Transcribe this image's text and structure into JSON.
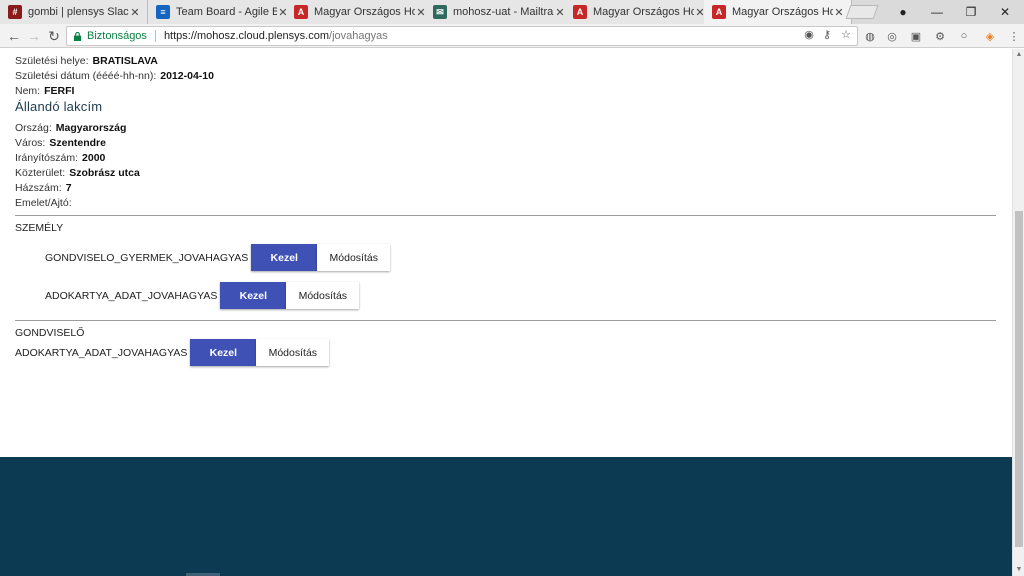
{
  "browser": {
    "tabs": [
      {
        "title": "gombi | plensys Slack",
        "icon_color": "#8b1a1a",
        "icon_glyph": "#"
      },
      {
        "title": "Team Board - Agile Boa",
        "icon_color": "#1565c0",
        "icon_glyph": "≡"
      },
      {
        "title": "Magyar Országos Horgá",
        "icon_color": "#c62828",
        "icon_glyph": "A"
      },
      {
        "title": "mohosz-uat - Mailtrap",
        "icon_color": "#2e6b5e",
        "icon_glyph": "✉"
      },
      {
        "title": "Magyar Országos Horgá",
        "icon_color": "#c62828",
        "icon_glyph": "A"
      },
      {
        "title": "Magyar Országos Horgá",
        "icon_color": "#c62828",
        "icon_glyph": "A"
      }
    ],
    "active_tab_index": 5,
    "secure_label": "Biztonságos",
    "url_scheme_host": "https://mohosz.cloud.plensys.com",
    "url_path": "/jovahagyas"
  },
  "person": {
    "fields": [
      {
        "label": "Születési helye:",
        "value": "BRATISLAVA"
      },
      {
        "label": "Születési dátum (éééé-hh-nn):",
        "value": "2012-04-10"
      },
      {
        "label": "Nem:",
        "value": "FERFI"
      }
    ]
  },
  "address": {
    "heading": "Állandó lakcím",
    "fields": [
      {
        "label": "Ország:",
        "value": "Magyarország"
      },
      {
        "label": "Város:",
        "value": "Szentendre"
      },
      {
        "label": "Irányítószám:",
        "value": "2000"
      },
      {
        "label": "Közterület:",
        "value": "Szobrász utca"
      },
      {
        "label": "Házszám:",
        "value": "7"
      },
      {
        "label": "Emelet/Ajtó:",
        "value": ""
      }
    ]
  },
  "szemely": {
    "title": "SZEMÉLY",
    "rows": [
      {
        "label": "GONDVISELO_GYERMEK_JOVAHAGYAS",
        "primary": "Kezel",
        "secondary": "Módosítás"
      },
      {
        "label": "ADOKARTYA_ADAT_JOVAHAGYAS",
        "primary": "Kezel",
        "secondary": "Módosítás"
      }
    ]
  },
  "gondviselo": {
    "title": "GONDVISELŐ",
    "rows": [
      {
        "label": "ADOKARTYA_ADAT_JOVAHAGYAS",
        "primary": "Kezel",
        "secondary": "Módosítás"
      }
    ]
  },
  "colors": {
    "primary_button": "#3f51b5",
    "footer": "#0b3a52",
    "secure_green": "#0b8043"
  }
}
